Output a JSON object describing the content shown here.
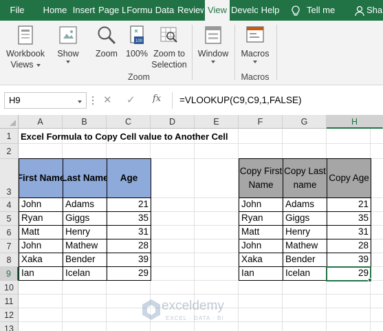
{
  "menu": {
    "tabs": [
      "File",
      "Home",
      "Insert",
      "Page L",
      "Formu",
      "Data",
      "Review",
      "View",
      "Develo",
      "Help"
    ],
    "active_tab": "View",
    "tell_me": "Tell me",
    "share": "Sha"
  },
  "ribbon": {
    "workbook_views_line1": "Workbook",
    "workbook_views_line2": "Views",
    "show": "Show",
    "zoom": "Zoom",
    "zoom_100": "100%",
    "zoom_to_selection_line1": "Zoom to",
    "zoom_to_selection_line2": "Selection",
    "zoom_group": "Zoom",
    "window": "Window",
    "macros": "Macros",
    "macros_group": "Macros"
  },
  "formula_bar": {
    "name_box": "H9",
    "cancel": "✕",
    "enter": "✓",
    "fx": "fx",
    "formula": "=VLOOKUP(C9,C9,1,FALSE)"
  },
  "sheet": {
    "columns": [
      "A",
      "B",
      "C",
      "D",
      "E",
      "F",
      "G",
      "H"
    ],
    "rows": [
      "1",
      "2",
      "3",
      "4",
      "5",
      "6",
      "7",
      "8",
      "9",
      "10",
      "11",
      "12",
      "13"
    ],
    "selected_column": "H",
    "selected_row": "9",
    "title": "Excel Formula to Copy Cell value to Another Cell",
    "table1": {
      "headers": [
        "First Name",
        "Last Name",
        "Age"
      ],
      "rows": [
        [
          "John",
          "Adams",
          "21"
        ],
        [
          "Ryan",
          "Giggs",
          "35"
        ],
        [
          "Matt",
          "Henry",
          "31"
        ],
        [
          "John",
          "Mathew",
          "28"
        ],
        [
          "Xaka",
          "Bender",
          "39"
        ],
        [
          "Ian",
          "Icelan",
          "29"
        ]
      ]
    },
    "table2": {
      "headers": [
        "Copy First Name",
        "Copy Last name",
        "Copy Age"
      ],
      "rows": [
        [
          "John",
          "Adams",
          "21"
        ],
        [
          "Ryan",
          "Giggs",
          "35"
        ],
        [
          "Matt",
          "Henry",
          "31"
        ],
        [
          "John",
          "Mathew",
          "28"
        ],
        [
          "Xaka",
          "Bender",
          "39"
        ],
        [
          "Ian",
          "Icelan",
          "29"
        ]
      ]
    }
  },
  "watermark": {
    "name": "exceldemy",
    "tagline": "EXCEL · DATA · BI"
  },
  "colors": {
    "excel_green": "#217346",
    "table1_header": "#8eaadb",
    "table2_header": "#a6a6a6"
  }
}
